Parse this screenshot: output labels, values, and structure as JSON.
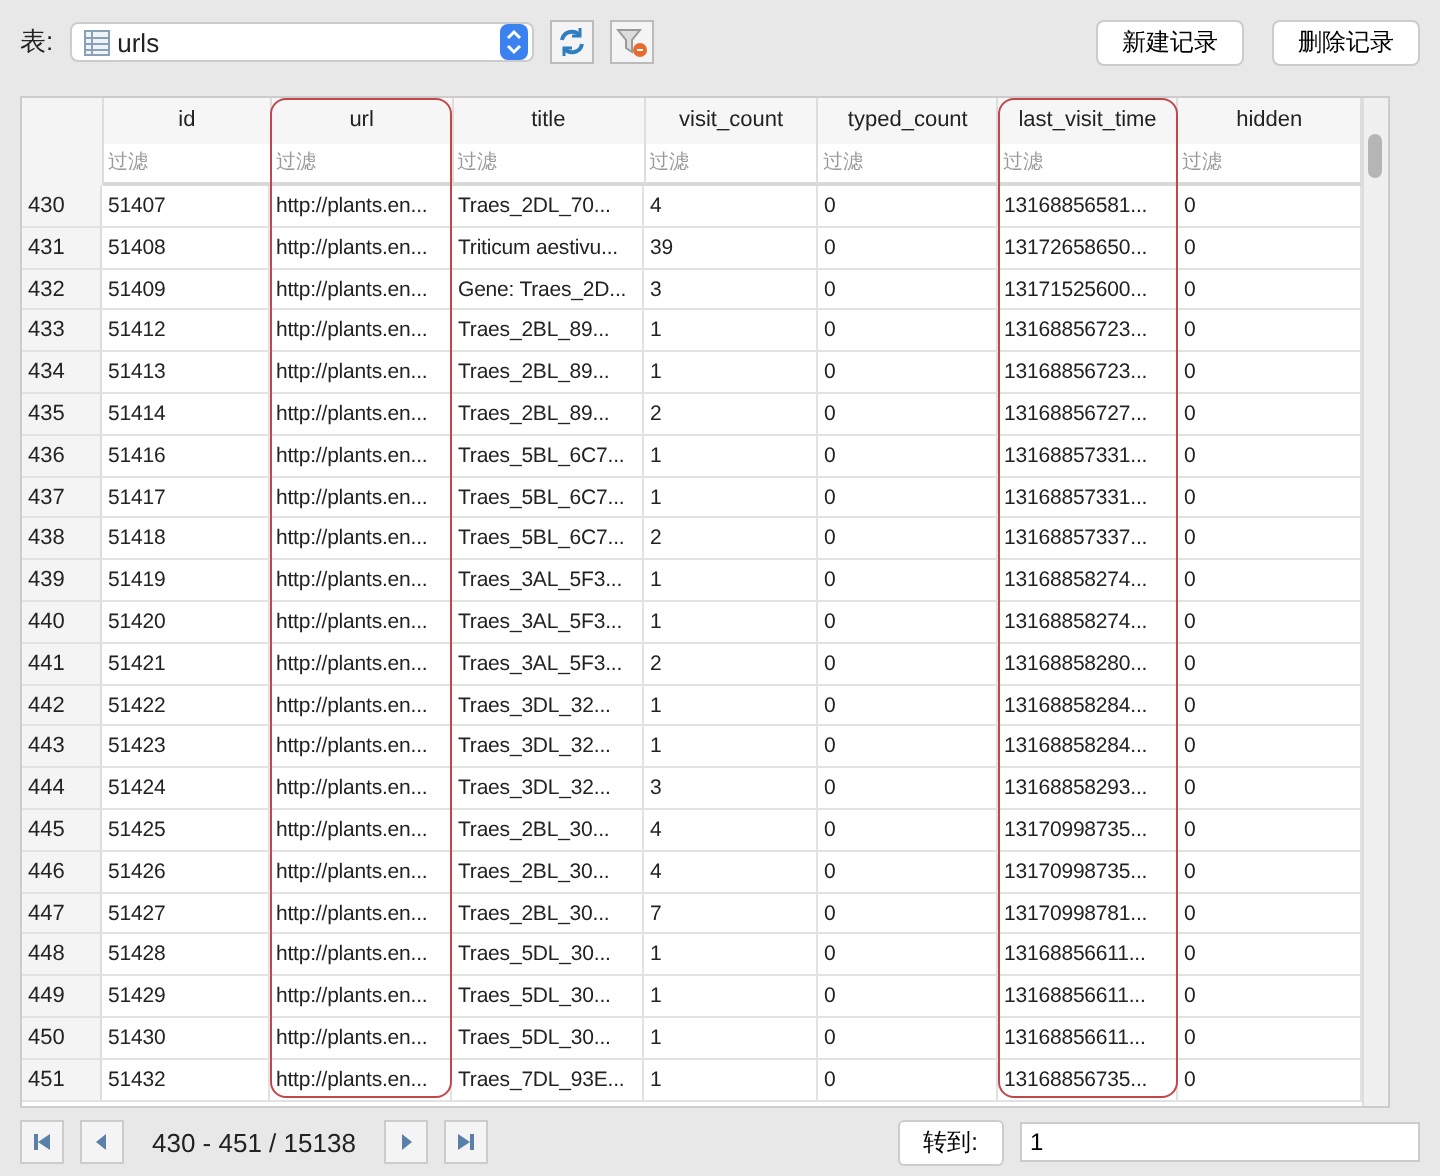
{
  "toolbar": {
    "table_label": "表:",
    "table_select": "urls",
    "buttons": [
      "新建记录",
      "删除记录"
    ]
  },
  "table": {
    "columns": [
      {
        "label": "id",
        "filter_placeholder": "过滤",
        "highlighted": false
      },
      {
        "label": "url",
        "filter_placeholder": "过滤",
        "highlighted": true
      },
      {
        "label": "title",
        "filter_placeholder": "过滤",
        "highlighted": false
      },
      {
        "label": "visit_count",
        "filter_placeholder": "过滤",
        "highlighted": false
      },
      {
        "label": "typed_count",
        "filter_placeholder": "过滤",
        "highlighted": false
      },
      {
        "label": "last_visit_time",
        "filter_placeholder": "过滤",
        "highlighted": true
      },
      {
        "label": "hidden",
        "filter_placeholder": "过滤",
        "highlighted": false
      }
    ],
    "rows": [
      {
        "number": "430",
        "cells": [
          "51407",
          "http://plants.en...",
          "Traes_2DL_70...",
          "4",
          "0",
          "13168856581...",
          "0"
        ]
      },
      {
        "number": "431",
        "cells": [
          "51408",
          "http://plants.en...",
          "Triticum aestivu...",
          "39",
          "0",
          "13172658650...",
          "0"
        ]
      },
      {
        "number": "432",
        "cells": [
          "51409",
          "http://plants.en...",
          "Gene: Traes_2D...",
          "3",
          "0",
          "13171525600...",
          "0"
        ]
      },
      {
        "number": "433",
        "cells": [
          "51412",
          "http://plants.en...",
          "Traes_2BL_89...",
          "1",
          "0",
          "13168856723...",
          "0"
        ]
      },
      {
        "number": "434",
        "cells": [
          "51413",
          "http://plants.en...",
          "Traes_2BL_89...",
          "1",
          "0",
          "13168856723...",
          "0"
        ]
      },
      {
        "number": "435",
        "cells": [
          "51414",
          "http://plants.en...",
          "Traes_2BL_89...",
          "2",
          "0",
          "13168856727...",
          "0"
        ]
      },
      {
        "number": "436",
        "cells": [
          "51416",
          "http://plants.en...",
          "Traes_5BL_6C7...",
          "1",
          "0",
          "13168857331...",
          "0"
        ]
      },
      {
        "number": "437",
        "cells": [
          "51417",
          "http://plants.en...",
          "Traes_5BL_6C7...",
          "1",
          "0",
          "13168857331...",
          "0"
        ]
      },
      {
        "number": "438",
        "cells": [
          "51418",
          "http://plants.en...",
          "Traes_5BL_6C7...",
          "2",
          "0",
          "13168857337...",
          "0"
        ]
      },
      {
        "number": "439",
        "cells": [
          "51419",
          "http://plants.en...",
          "Traes_3AL_5F3...",
          "1",
          "0",
          "13168858274...",
          "0"
        ]
      },
      {
        "number": "440",
        "cells": [
          "51420",
          "http://plants.en...",
          "Traes_3AL_5F3...",
          "1",
          "0",
          "13168858274...",
          "0"
        ]
      },
      {
        "number": "441",
        "cells": [
          "51421",
          "http://plants.en...",
          "Traes_3AL_5F3...",
          "2",
          "0",
          "13168858280...",
          "0"
        ]
      },
      {
        "number": "442",
        "cells": [
          "51422",
          "http://plants.en...",
          "Traes_3DL_32...",
          "1",
          "0",
          "13168858284...",
          "0"
        ]
      },
      {
        "number": "443",
        "cells": [
          "51423",
          "http://plants.en...",
          "Traes_3DL_32...",
          "1",
          "0",
          "13168858284...",
          "0"
        ]
      },
      {
        "number": "444",
        "cells": [
          "51424",
          "http://plants.en...",
          "Traes_3DL_32...",
          "3",
          "0",
          "13168858293...",
          "0"
        ]
      },
      {
        "number": "445",
        "cells": [
          "51425",
          "http://plants.en...",
          "Traes_2BL_30...",
          "4",
          "0",
          "13170998735...",
          "0"
        ]
      },
      {
        "number": "446",
        "cells": [
          "51426",
          "http://plants.en...",
          "Traes_2BL_30...",
          "4",
          "0",
          "13170998735...",
          "0"
        ]
      },
      {
        "number": "447",
        "cells": [
          "51427",
          "http://plants.en...",
          "Traes_2BL_30...",
          "7",
          "0",
          "13170998781...",
          "0"
        ]
      },
      {
        "number": "448",
        "cells": [
          "51428",
          "http://plants.en...",
          "Traes_5DL_30...",
          "1",
          "0",
          "13168856611...",
          "0"
        ]
      },
      {
        "number": "449",
        "cells": [
          "51429",
          "http://plants.en...",
          "Traes_5DL_30...",
          "1",
          "0",
          "13168856611...",
          "0"
        ]
      },
      {
        "number": "450",
        "cells": [
          "51430",
          "http://plants.en...",
          "Traes_5DL_30...",
          "1",
          "0",
          "13168856611...",
          "0"
        ]
      },
      {
        "number": "451",
        "cells": [
          "51432",
          "http://plants.en...",
          "Traes_7DL_93E...",
          "1",
          "0",
          "13168856735...",
          "0"
        ]
      }
    ]
  },
  "pager": {
    "range": "430 - 451 / 15138",
    "goto_button": "转到:",
    "goto_value": "1"
  }
}
